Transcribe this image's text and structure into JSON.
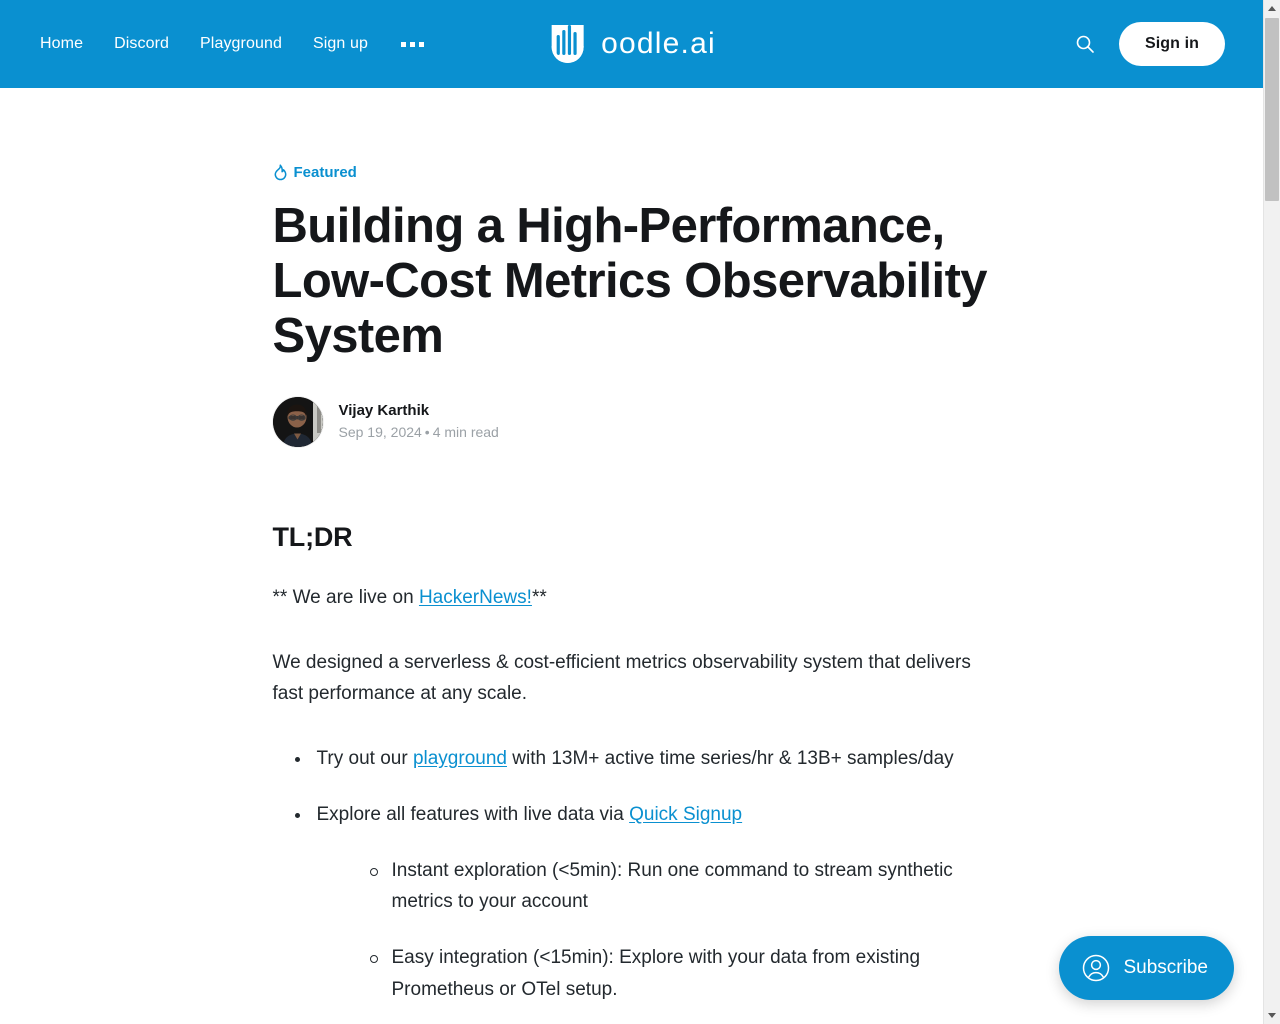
{
  "colors": {
    "brand_blue": "#0a90d0",
    "link_blue": "#0a90d0",
    "text_dark": "#15171a",
    "body_text": "#23292e",
    "meta_gray": "#9ba1a6"
  },
  "header": {
    "nav": [
      {
        "label": "Home",
        "name": "nav-link-home"
      },
      {
        "label": "Discord",
        "name": "nav-link-discord"
      },
      {
        "label": "Playground",
        "name": "nav-link-playground"
      },
      {
        "label": "Sign up",
        "name": "nav-link-signup"
      }
    ],
    "more_menu_icon": "ellipsis-icon",
    "brand": {
      "name": "oodle.ai",
      "logo_icon": "oodle-bars-logo-icon"
    },
    "search_icon": "search-icon",
    "signin_label": "Sign in"
  },
  "article": {
    "featured": {
      "icon": "flame-icon",
      "label": "Featured"
    },
    "title": "Building a High-Performance, Low-Cost Metrics Observability System",
    "author": {
      "name": "Vijay Karthik",
      "avatar_icon": "author-avatar-photo",
      "date": "Sep 19, 2024",
      "separator": "•",
      "read_time": "4 min read"
    },
    "section_heading": "TL;DR",
    "hn_line": {
      "prefix": "** We are live on ",
      "link": "HackerNews!",
      "suffix": "**"
    },
    "intro": "We designed a serverless & cost-efficient metrics observability system that delivers fast performance at any scale.",
    "bullets": [
      {
        "prefix": "Try out our ",
        "link": "playground",
        "suffix": " with 13M+ active time series/hr & 13B+ samples/day"
      },
      {
        "prefix": "Explore all features with live data via ",
        "link": "Quick Signup",
        "suffix": ""
      }
    ],
    "sub_bullets": [
      "Instant exploration (<5min): Run one command to stream synthetic metrics to your account",
      "Easy integration (<15min): Explore with your data from existing Prometheus or OTel setup."
    ]
  },
  "subscribe": {
    "label": "Subscribe",
    "icon": "user-circle-icon"
  },
  "scrollbar": {
    "up_arrow_icon": "scroll-up-arrow-icon",
    "down_arrow_icon": "scroll-down-arrow-icon"
  }
}
